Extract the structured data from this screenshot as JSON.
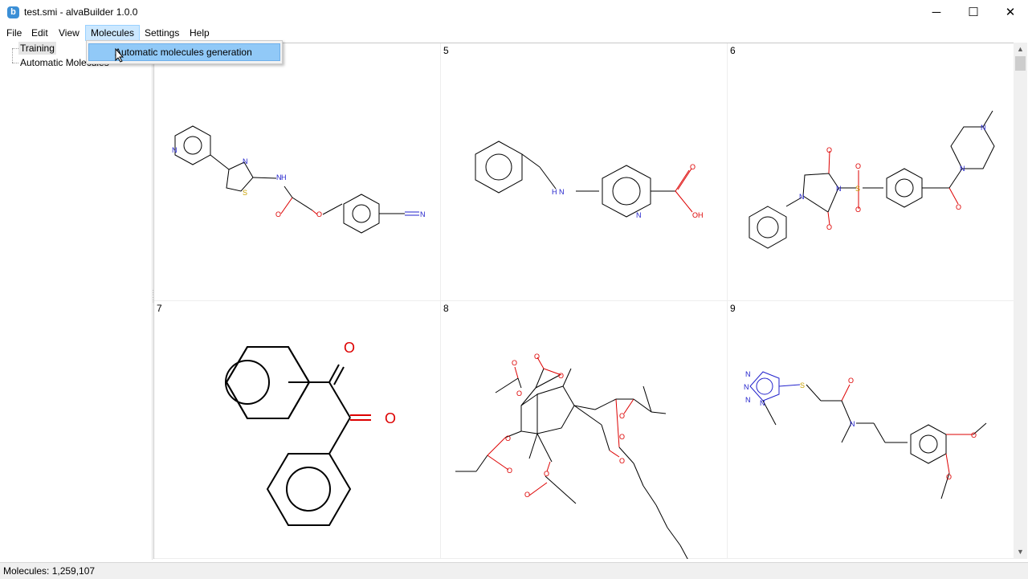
{
  "window": {
    "title": "test.smi - alvaBuilder 1.0.0",
    "app_icon_letter": "b",
    "minimize": "─",
    "maximize": "☐",
    "close": "✕"
  },
  "menu": {
    "file": "File",
    "edit": "Edit",
    "view": "View",
    "molecules": "Molecules",
    "settings": "Settings",
    "help": "Help"
  },
  "dropdown": {
    "auto_generation": "Automatic molecules generation"
  },
  "tree": {
    "items": [
      {
        "label": "Training",
        "selected": true
      },
      {
        "label": "Automatic Molecules",
        "selected": false
      }
    ]
  },
  "grid": {
    "cells": [
      {
        "number": ""
      },
      {
        "number": "5"
      },
      {
        "number": "6"
      },
      {
        "number": "7"
      },
      {
        "number": "8"
      },
      {
        "number": "9"
      }
    ]
  },
  "scrollbar": {
    "up": "▲",
    "down": "▼"
  },
  "status": {
    "text": "Molecules: 1,259,107"
  },
  "atoms": {
    "n": "N",
    "nh": "H",
    "o": "O",
    "oh": "OH",
    "s": "S"
  },
  "colors": {
    "oxygen": "#dd0000",
    "nitrogen": "#2222cc",
    "sulfur": "#c8a000",
    "selection": "#91c9f7"
  }
}
